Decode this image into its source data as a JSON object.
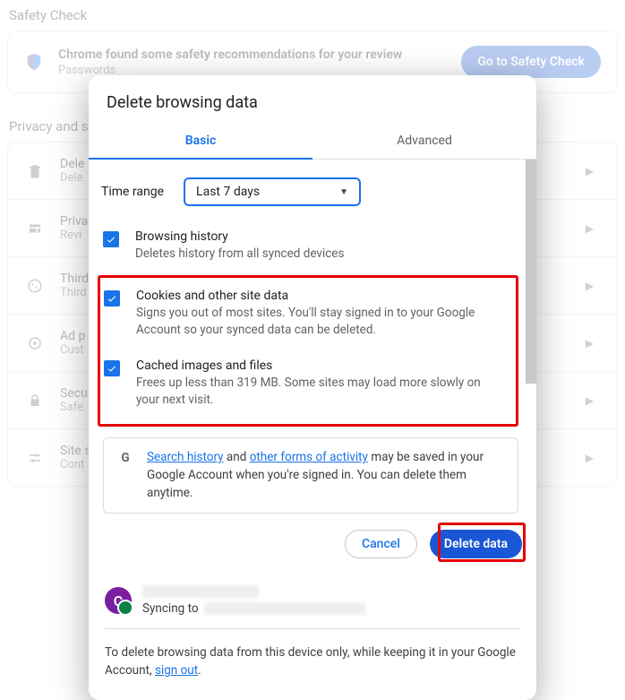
{
  "bg": {
    "safety_heading": "Safety Check",
    "safety_headline": "Chrome found some safety recommendations for your review",
    "safety_sub": "Passwords",
    "safety_button": "Go to Safety Check",
    "privacy_heading": "Privacy and s",
    "rows": [
      {
        "title": "Dele",
        "sub": "Dele"
      },
      {
        "title": "Priva",
        "sub": "Revi"
      },
      {
        "title": "Third",
        "sub": "Third"
      },
      {
        "title": "Ad p",
        "sub": "Cust"
      },
      {
        "title": "Secu",
        "sub": "Safe"
      },
      {
        "title": "Site s",
        "sub": "Cont"
      }
    ]
  },
  "modal": {
    "title": "Delete browsing data",
    "tabs": {
      "basic": "Basic",
      "advanced": "Advanced"
    },
    "time_label": "Time range",
    "time_value": "Last 7 days",
    "items": [
      {
        "title": "Browsing history",
        "desc": "Deletes history from all synced devices"
      },
      {
        "title": "Cookies and other site data",
        "desc": "Signs you out of most sites. You'll stay signed in to your Google Account so your synced data can be deleted."
      },
      {
        "title": "Cached images and files",
        "desc": "Frees up less than 319 MB. Some sites may load more slowly on your next visit."
      }
    ],
    "info": {
      "link1": "Search history",
      "conjoin": " and ",
      "link2": "other forms of activity",
      "tail": " may be saved in your Google Account when you're signed in. You can delete them anytime."
    },
    "cancel": "Cancel",
    "delete": "Delete data",
    "avatar_initial": "C",
    "sync_prefix": "Syncing to",
    "footer_pre": "To delete browsing data from this device only, while keeping it in your Google Account, ",
    "footer_link": "sign out",
    "footer_post": "."
  }
}
